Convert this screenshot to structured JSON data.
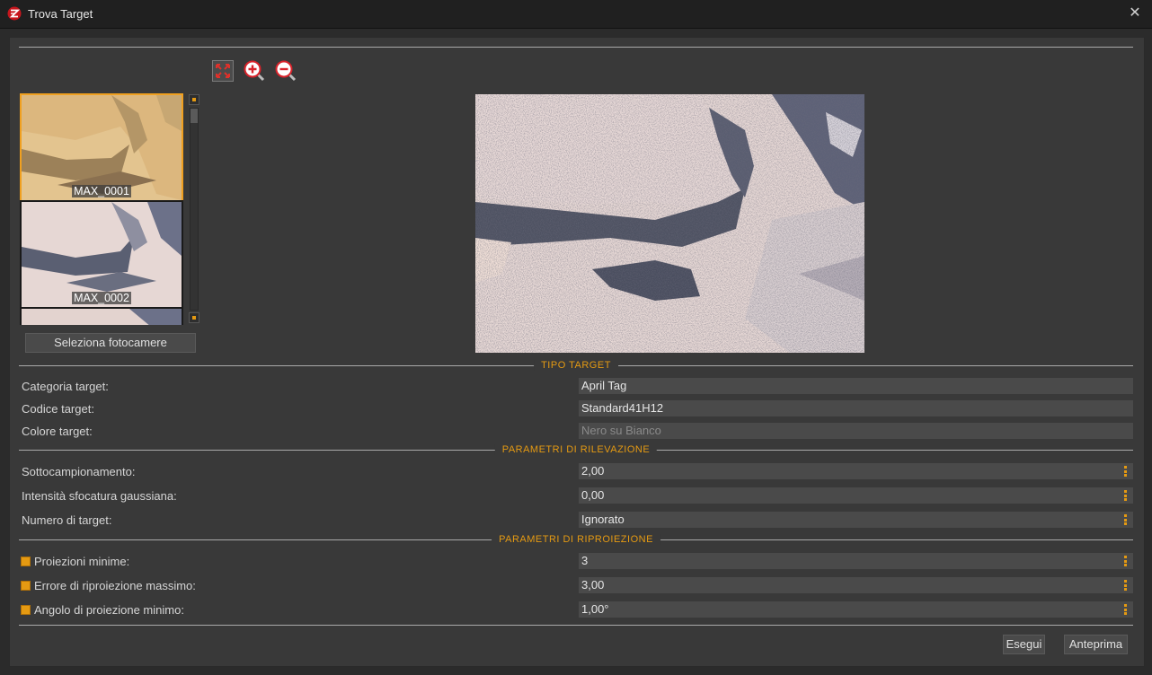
{
  "window": {
    "title": "Trova Target",
    "close_symbol": "✕"
  },
  "toolbar": {
    "fit_icon": "fit-to-window-icon",
    "zoom_in_icon": "zoom-in-icon",
    "zoom_out_icon": "zoom-out-icon"
  },
  "cameras": [
    {
      "label": "MAX_0001",
      "selected": true
    },
    {
      "label": "MAX_0002",
      "selected": false
    }
  ],
  "select_cameras_button": "Seleziona fotocamere",
  "tipo_target": {
    "title": "TIPO TARGET",
    "rows": [
      {
        "label": "Categoria target:",
        "value": "April Tag"
      },
      {
        "label": "Codice target:",
        "value": "Standard41H12"
      },
      {
        "label": "Colore target:",
        "value": "Nero su Bianco",
        "disabled": true
      }
    ]
  },
  "rilevazione": {
    "title": "PARAMETRI DI RILEVAZIONE",
    "rows": [
      {
        "label": "Sottocampionamento:",
        "value": "2,00"
      },
      {
        "label": "Intensità sfocatura gaussiana:",
        "value": "0,00"
      },
      {
        "label": "Numero di target:",
        "value": "Ignorato"
      }
    ]
  },
  "riproiezione": {
    "title": "PARAMETRI DI RIPROIEZIONE",
    "rows": [
      {
        "label": "Proiezioni minime:",
        "value": "3",
        "checked": true
      },
      {
        "label": "Errore di riproiezione massimo:",
        "value": "3,00",
        "checked": true
      },
      {
        "label": "Angolo di proiezione minimo:",
        "value": "1,00°",
        "checked": true
      }
    ]
  },
  "buttons": {
    "run": "Esegui",
    "preview": "Anteprima"
  },
  "colors": {
    "accent": "#e59a12",
    "panel": "#393939",
    "field": "#4a4a4a"
  }
}
